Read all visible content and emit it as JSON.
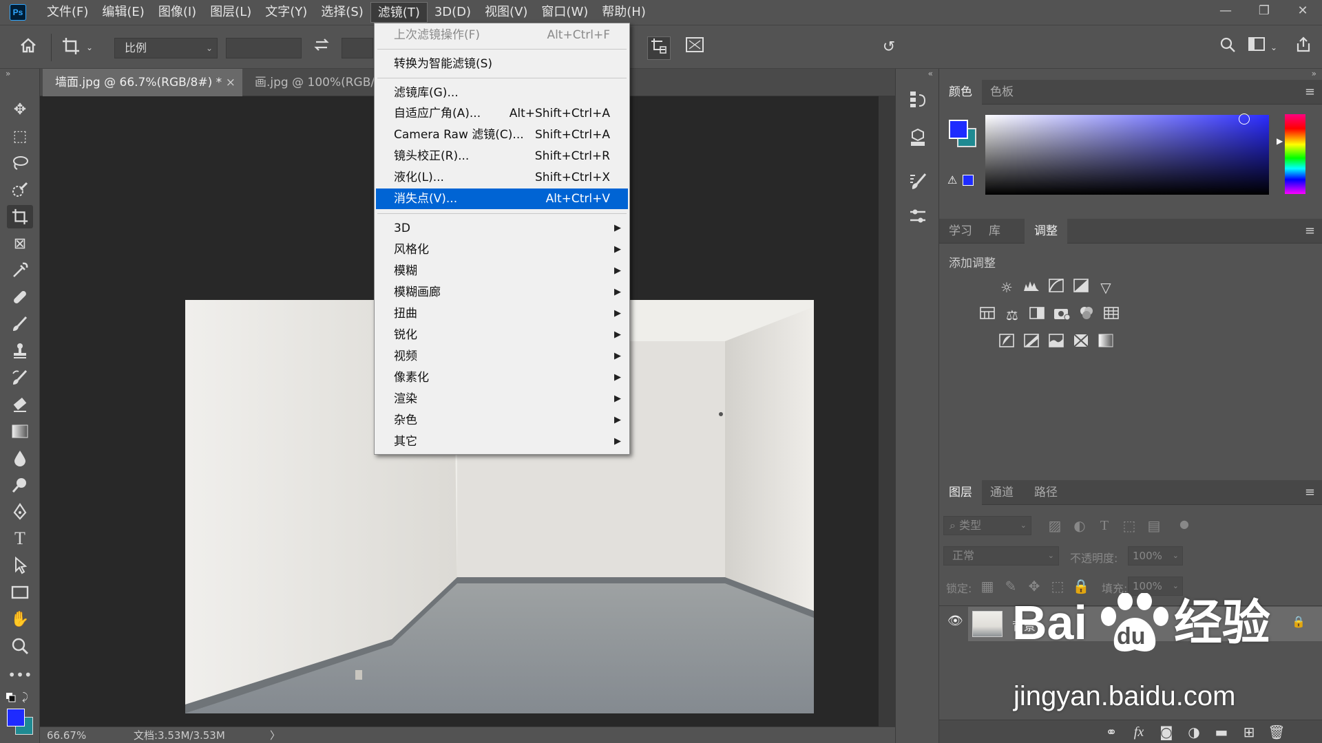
{
  "app": {
    "logo": "Ps"
  },
  "menubar": {
    "items": [
      "文件(F)",
      "编辑(E)",
      "图像(I)",
      "图层(L)",
      "文字(Y)",
      "选择(S)",
      "滤镜(T)",
      "3D(D)",
      "视图(V)",
      "窗口(W)",
      "帮助(H)"
    ],
    "active_index": 6
  },
  "options_bar": {
    "ratio_select": "比例"
  },
  "documents": {
    "tabs": [
      {
        "title": "墙面.jpg @ 66.7%(RGB/8#) *",
        "close": "×"
      },
      {
        "title": "画.jpg @ 100%(RGB/8#)"
      }
    ]
  },
  "status": {
    "zoom": "66.67%",
    "doc": "文档:3.53M/3.53M",
    "more": "〉"
  },
  "filter_menu": {
    "items": [
      {
        "label": "上次滤镜操作(F)",
        "shortcut": "Alt+Ctrl+F",
        "disabled": true
      },
      {
        "label": "转换为智能滤镜(S)",
        "shortcut": ""
      },
      {
        "label": "滤镜库(G)...",
        "shortcut": ""
      },
      {
        "label": "自适应广角(A)...",
        "shortcut": "Alt+Shift+Ctrl+A"
      },
      {
        "label": "Camera Raw 滤镜(C)...",
        "shortcut": "Shift+Ctrl+A"
      },
      {
        "label": "镜头校正(R)...",
        "shortcut": "Shift+Ctrl+R"
      },
      {
        "label": "液化(L)...",
        "shortcut": "Shift+Ctrl+X"
      },
      {
        "label": "消失点(V)...",
        "shortcut": "Alt+Ctrl+V",
        "highlighted": true
      },
      {
        "label": "3D",
        "submenu": true
      },
      {
        "label": "风格化",
        "submenu": true
      },
      {
        "label": "模糊",
        "submenu": true
      },
      {
        "label": "模糊画廊",
        "submenu": true
      },
      {
        "label": "扭曲",
        "submenu": true
      },
      {
        "label": "锐化",
        "submenu": true
      },
      {
        "label": "视频",
        "submenu": true
      },
      {
        "label": "像素化",
        "submenu": true
      },
      {
        "label": "渲染",
        "submenu": true
      },
      {
        "label": "杂色",
        "submenu": true
      },
      {
        "label": "其它",
        "submenu": true
      }
    ]
  },
  "color_panel": {
    "tabs": [
      "颜色",
      "色板"
    ],
    "fg": "#1e2bff",
    "bg": "#1f8a92",
    "hue": "#2b2cff"
  },
  "adjust_panel": {
    "tabs": [
      "学习",
      "库",
      "调整"
    ],
    "title": "添加调整"
  },
  "layers_panel": {
    "tabs": [
      "图层",
      "通道",
      "路径"
    ],
    "filter_placeholder": "类型",
    "blend_mode": "正常",
    "opacity_label": "不透明度:",
    "opacity_value": "100%",
    "lock_label": "锁定:",
    "fill_label": "填充:",
    "fill_value": "100%",
    "layers": [
      {
        "name": "背景"
      }
    ]
  },
  "watermark": {
    "brand": "Bai经验",
    "paw": "du",
    "url": "jingyan.baidu.com"
  }
}
